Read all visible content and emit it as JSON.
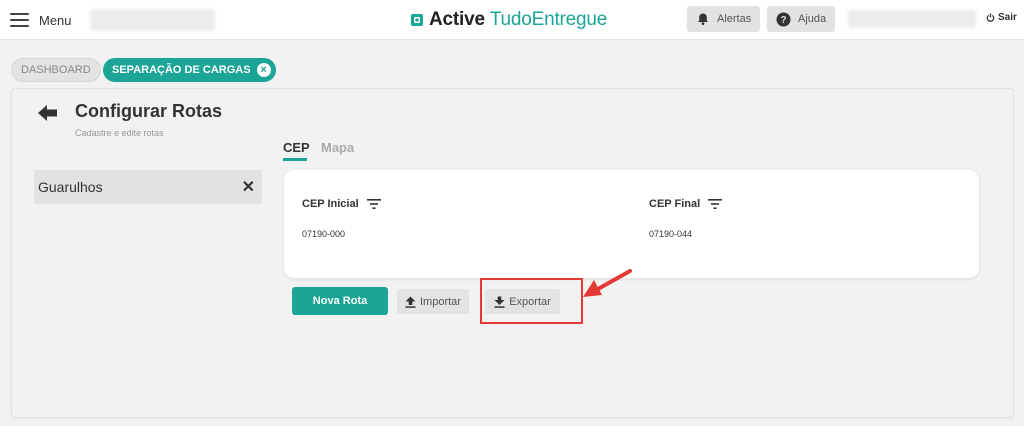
{
  "header": {
    "menu_label": "Menu",
    "brand_bold": "Active",
    "brand_light": "TudoEntregue",
    "alerts_label": "Alertas",
    "help_label": "Ajuda",
    "logout_label": "Sair"
  },
  "breadcrumb": {
    "items": [
      "DASHBOARD",
      "SEPARAÇÃO DE CARGAS"
    ]
  },
  "page": {
    "title": "Configurar Rotas",
    "subtitle": "Cadastre e edite rotas"
  },
  "routes": [
    {
      "label": "Guarulhos"
    }
  ],
  "tabs": [
    "CEP",
    "Mapa"
  ],
  "table": {
    "columns": [
      "CEP Inicial",
      "CEP Final"
    ],
    "rows": [
      [
        "07190-000",
        "07190-044"
      ]
    ]
  },
  "actions": {
    "new_route": "Nova Rota",
    "import": "Importar",
    "export": "Exportar"
  },
  "colors": {
    "accent": "#1aa596",
    "annotation": "#e53935"
  },
  "icons": [
    "hamburger-icon",
    "brand-logo-icon",
    "bell-icon",
    "help-icon",
    "power-icon",
    "close-icon",
    "back-arrow-icon",
    "filter-icon",
    "upload-icon",
    "download-icon"
  ]
}
